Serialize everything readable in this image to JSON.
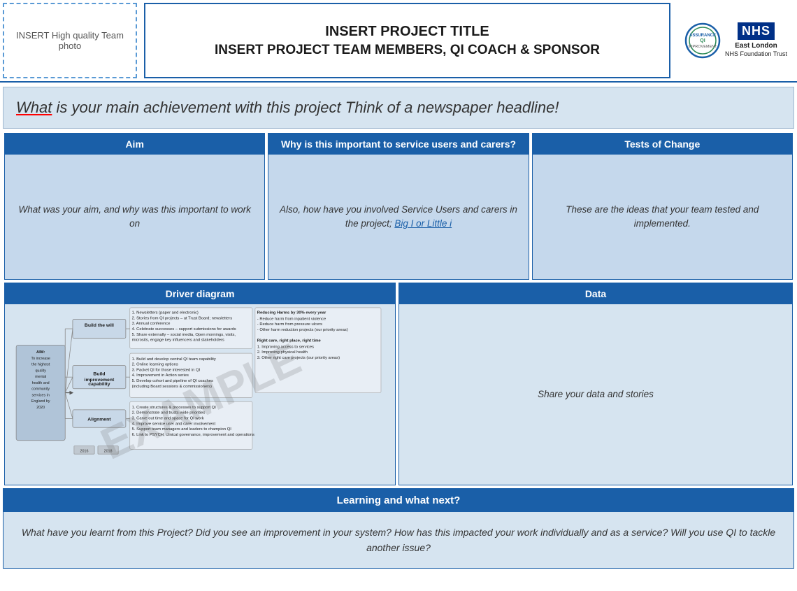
{
  "header": {
    "photo_placeholder": "INSERT High quality Team photo",
    "title_line1": "INSERT PROJECT TITLE",
    "title_line2": "INSERT PROJECT TEAM MEMBERS, QI COACH & SPONSOR",
    "nhs_label": "NHS",
    "nhs_trust": "East London\nNHS Foundation Trust"
  },
  "headline": {
    "text_before": "What",
    "text_after": " is your main achievement with this project  Think of a newspaper headline!"
  },
  "aim": {
    "header": "Aim",
    "body": "What was your aim, and why was this important to work on"
  },
  "importance": {
    "header": "Why is this important to service users and carers?",
    "body_before": "Also, how have you involved Service Users and carers in the project; ",
    "body_link": "Big I or Little i",
    "body_after": ""
  },
  "tests": {
    "header": "Tests of Change",
    "body": "These are the ideas that your team tested and implemented."
  },
  "driver": {
    "header": "Driver diagram",
    "watermark": "EXAMPLE",
    "aim_text": "AIM: To increase the highest quality mental health and community services in England by 2020",
    "primary_drivers": [
      {
        "label": "Build the will"
      },
      {
        "label": "Build improvement capability"
      },
      {
        "label": "Alignment"
      },
      {
        "label": ""
      }
    ],
    "secondary_drivers": [
      {
        "primary": "Build the will",
        "items": [
          "1. Newsletters (paper and electronic)",
          "2. Stories from QI projects – at Trust Board; newsletters",
          "3. Annual conference",
          "4. Celebrate successes – support submissions for awards",
          "5. Share externally – social media, Open mornings, visits, microsits, engage key influencers and stakeholders"
        ]
      },
      {
        "primary": "Build improvement capability",
        "items": [
          "1. Build and develop central QI team capability",
          "2. Online learning options",
          "3. Packet QI for those interested in QI",
          "4. Improvement in Action series",
          "5. Develop cohort and pipeline of QI coaches (including Board sessions & commissioners)"
        ]
      },
      {
        "primary": "Alignment",
        "items": [
          "1. Create structures & processes to support QI",
          "2. Demonstrating and trusts-wide priorities",
          "3. Carve out time and space for QI work",
          "4. Improve service user and carer involvement",
          "5. Support team managers and leaders to champion QI",
          "6. Link to PSYCH, clinical governance, improvement and operations"
        ]
      },
      {
        "primary": "",
        "items": [
          "Reducing Harms by 30% every year",
          "- Reduce harm from inpatient violence",
          "- Reduce harm from pressure ulcers",
          "- Other harm reduction projects (our priority areas)",
          "",
          "Right care, right place, right time",
          "1. Improving access to services",
          "2. Improving physical health",
          "3. Other right care projects (our priority areas)"
        ]
      }
    ]
  },
  "data": {
    "header": "Data",
    "body": "Share your data and stories"
  },
  "learning": {
    "header": "Learning and what next?",
    "body": "What have you learnt from this Project? Did you see an improvement in your system? How has this impacted your work individually and as a service? Will you use QI to tackle another issue?"
  }
}
